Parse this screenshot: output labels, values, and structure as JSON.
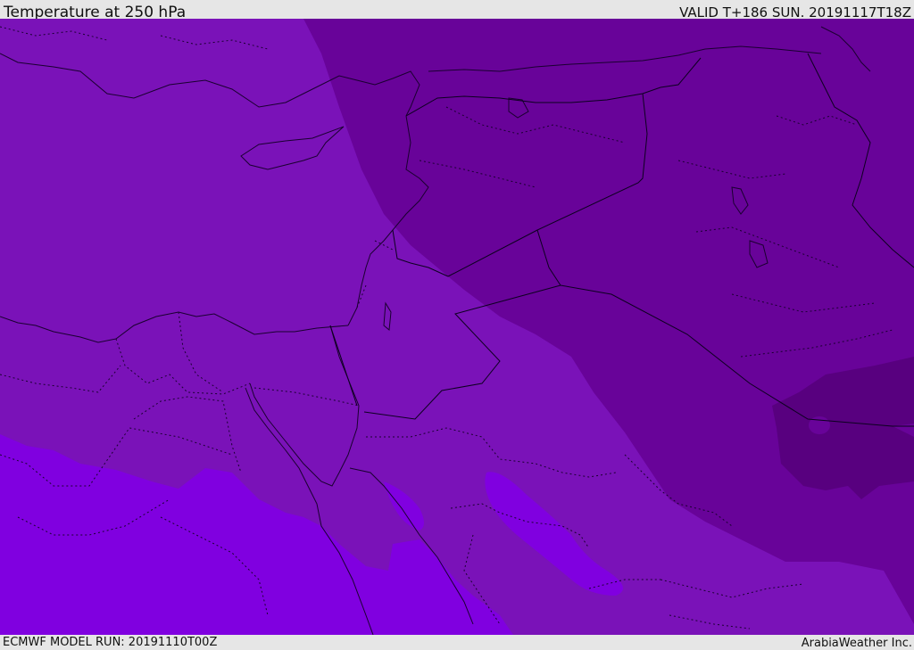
{
  "header": {
    "title": "Temperature at 250 hPa",
    "valid": "VALID T+186 SUN. 20191117T18Z"
  },
  "footer": {
    "model_run": "ECMWF MODEL RUN: 20191110T00Z",
    "brand": "ArabiaWeather Inc."
  },
  "map": {
    "field": "temperature",
    "level": "250 hPa",
    "colors": {
      "mid_purple": "#7a12b8",
      "dark_purple": "#680399",
      "darkest_purple": "#58007f",
      "bright_violet": "#8000e0",
      "coast_line": "#1a0030",
      "border_line": "#0d0020"
    }
  }
}
